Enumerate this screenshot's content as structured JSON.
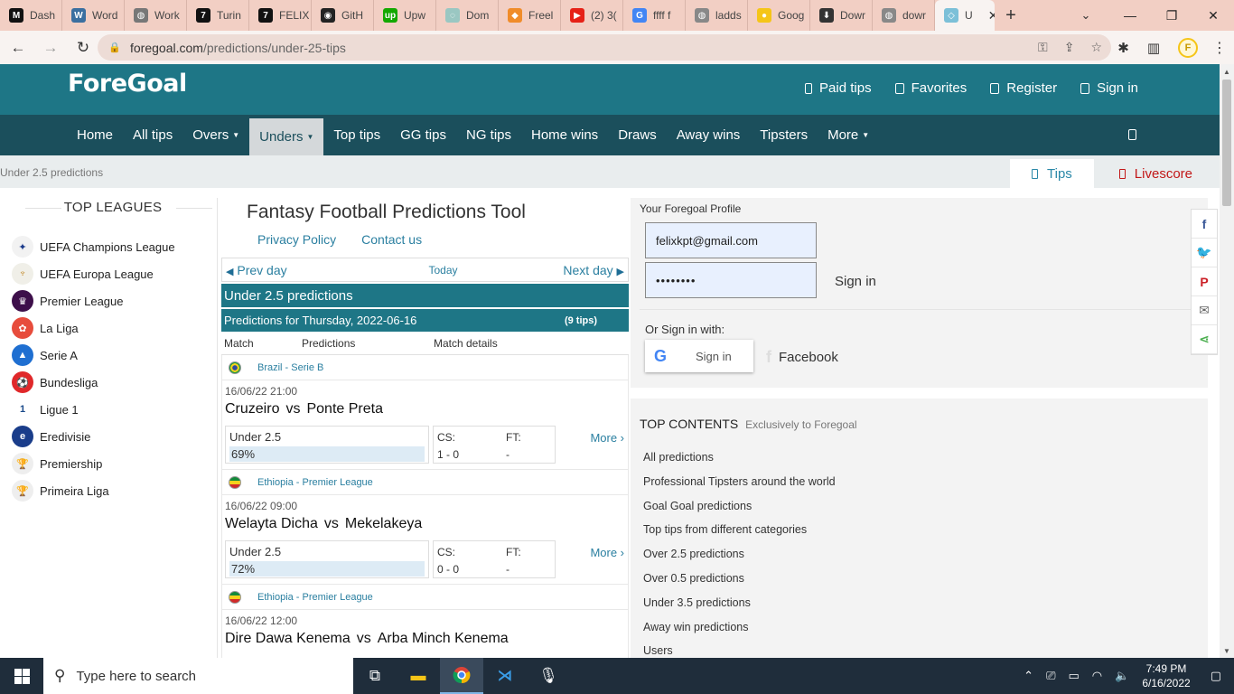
{
  "browser": {
    "tabs": [
      {
        "label": "Dash",
        "icon": "dashboard-icon",
        "color": "#111111",
        "glyph": "M"
      },
      {
        "label": "Word",
        "icon": "wordpress-icon",
        "color": "#3b6fa0",
        "glyph": "W"
      },
      {
        "label": "Work",
        "icon": "globe-icon",
        "color": "#777777",
        "glyph": "◍"
      },
      {
        "label": "Turin",
        "icon": "turing-icon",
        "color": "#111111",
        "glyph": "7"
      },
      {
        "label": "FELIX",
        "icon": "turing-icon",
        "color": "#111111",
        "glyph": "7"
      },
      {
        "label": "GitH",
        "icon": "github-icon",
        "color": "#222222",
        "glyph": "◉"
      },
      {
        "label": "Upw",
        "icon": "upwork-icon",
        "color": "#14a800",
        "glyph": "up"
      },
      {
        "label": "Dom",
        "icon": "domain-icon",
        "color": "#9ac7c2",
        "glyph": "◌"
      },
      {
        "label": "Freel",
        "icon": "freelancer-icon",
        "color": "#f08c2a",
        "glyph": "◆"
      },
      {
        "label": "(2) 3(",
        "icon": "youtube-icon",
        "color": "#e62117",
        "glyph": "▶"
      },
      {
        "label": "ffff f",
        "icon": "google-icon",
        "color": "#4285f4",
        "glyph": "G"
      },
      {
        "label": "ladds",
        "icon": "globe-icon",
        "color": "#888888",
        "glyph": "◍"
      },
      {
        "label": "Goog",
        "icon": "bulb-icon",
        "color": "#f5c518",
        "glyph": "●"
      },
      {
        "label": "Dowr",
        "icon": "download-icon",
        "color": "#333333",
        "glyph": "⬇"
      },
      {
        "label": "dowr",
        "icon": "globe-icon",
        "color": "#888888",
        "glyph": "◍"
      },
      {
        "label": "U",
        "icon": "foregoal-icon",
        "color": "#7cc0d8",
        "glyph": "◇",
        "active": true
      }
    ],
    "url_host": "foregoal.com",
    "url_path": "/predictions/under-25-tips",
    "profile_initial": "F"
  },
  "site": {
    "logo": "ForeGoal",
    "top_links": [
      "Paid tips",
      "Favorites",
      "Register",
      "Sign in"
    ],
    "nav": [
      {
        "label": "Home",
        "caret": false
      },
      {
        "label": "All tips",
        "caret": false
      },
      {
        "label": "Overs",
        "caret": true
      },
      {
        "label": "Unders",
        "caret": true,
        "active": true
      },
      {
        "label": "Top tips",
        "caret": false
      },
      {
        "label": "GG tips",
        "caret": false
      },
      {
        "label": "NG tips",
        "caret": false
      },
      {
        "label": "Home wins",
        "caret": false
      },
      {
        "label": "Draws",
        "caret": false
      },
      {
        "label": "Away wins",
        "caret": false
      },
      {
        "label": "Tipsters",
        "caret": false
      },
      {
        "label": "More",
        "caret": true
      }
    ],
    "breadcrumb": "Under 2.5 predictions",
    "tab_tips": "Tips",
    "tab_livescore": "Livescore"
  },
  "leagues": {
    "header": "TOP LEAGUES",
    "items": [
      {
        "label": "UEFA Champions League",
        "color": "#f2f2f2",
        "text": "#1a3a8a",
        "glyph": "✦"
      },
      {
        "label": "UEFA Europa League",
        "color": "#f0efe8",
        "text": "#c28a2a",
        "glyph": "♆"
      },
      {
        "label": "Premier League",
        "color": "#3d0f4a",
        "text": "#ffffff",
        "glyph": "♛"
      },
      {
        "label": "La Liga",
        "color": "#e74c3c",
        "text": "#ffffff",
        "glyph": "✿"
      },
      {
        "label": "Serie A",
        "color": "#1f6fd1",
        "text": "#ffffff",
        "glyph": "▲"
      },
      {
        "label": "Bundesliga",
        "color": "#e0282a",
        "text": "#ffffff",
        "glyph": "⚽"
      },
      {
        "label": "Ligue 1",
        "color": "#ffffff",
        "text": "#1a4a8a",
        "glyph": "1"
      },
      {
        "label": "Eredivisie",
        "color": "#1a3d8a",
        "text": "#ffffff",
        "glyph": "e"
      },
      {
        "label": "Premiership",
        "color": "#eeeeee",
        "text": "#bbbbbb",
        "glyph": "🏆"
      },
      {
        "label": "Primeira Liga",
        "color": "#eeeeee",
        "text": "#bbbbbb",
        "glyph": "🏆"
      }
    ]
  },
  "center": {
    "title": "Fantasy Football Predictions Tool",
    "privacy": "Privacy Policy",
    "contact": "Contact us",
    "prev_day": "Prev day",
    "today": "Today",
    "next_day": "Next day",
    "section_title": "Under 2.5 predictions",
    "date_heading": "Predictions for Thursday, 2022-06-16",
    "tip_count": "(9 tips)",
    "col_match": "Match",
    "col_predictions": "Predictions",
    "col_details": "Match details",
    "matches": [
      {
        "competition": "Brazil - Serie B",
        "flag": "br",
        "datetime": "16/06/22 21:00",
        "home": "Cruzeiro",
        "away": "Ponte Preta",
        "pred_label": "Under 2.5",
        "pred_pct": "69%",
        "cs_label": "CS:",
        "ft_label": "FT:",
        "cs_value": "1 - 0",
        "ft_value": "-",
        "more": "More ›"
      },
      {
        "competition": "Ethiopia - Premier League",
        "flag": "et",
        "datetime": "16/06/22 09:00",
        "home": "Welayta Dicha",
        "away": "Mekelakeya",
        "pred_label": "Under 2.5",
        "pred_pct": "72%",
        "cs_label": "CS:",
        "ft_label": "FT:",
        "cs_value": "0 - 0",
        "ft_value": "-",
        "more": "More ›"
      },
      {
        "competition": "Ethiopia - Premier League",
        "flag": "et",
        "datetime": "16/06/22 12:00",
        "home": "Dire Dawa Kenema",
        "away": "Arba Minch Kenema",
        "pred_label": "",
        "pred_pct": "",
        "cs_label": "",
        "ft_label": "",
        "cs_value": "",
        "ft_value": "",
        "more": ""
      }
    ],
    "vs": "vs"
  },
  "profile": {
    "label": "Your Foregoal Profile",
    "email": "felixkpt@gmail.com",
    "password": "••••••••",
    "signin": "Sign in",
    "or_sign_in": "Or Sign in with:",
    "google_signin": "Sign in",
    "facebook": "Facebook"
  },
  "top_contents": {
    "title": "TOP CONTENTS",
    "subtitle": "Exclusively to Foregoal",
    "items": [
      "All predictions",
      "Professional Tipsters around the world",
      "Goal Goal predictions",
      "Top tips from different categories",
      "Over 2.5 predictions",
      "Over 0.5 predictions",
      "Under 3.5 predictions",
      "Away win predictions",
      "Users"
    ]
  },
  "share": [
    {
      "icon": "facebook-icon",
      "glyph": "f",
      "color": "#3b5998"
    },
    {
      "icon": "twitter-icon",
      "glyph": "🐦",
      "color": "#1da1f2"
    },
    {
      "icon": "pinterest-icon",
      "glyph": "P",
      "color": "#cb2027"
    },
    {
      "icon": "email-icon",
      "glyph": "✉",
      "color": "#666666"
    },
    {
      "icon": "share-icon",
      "glyph": "⋖",
      "color": "#4caf50"
    }
  ],
  "taskbar": {
    "search_placeholder": "Type here to search",
    "time": "7:49 PM",
    "date": "6/16/2022"
  }
}
